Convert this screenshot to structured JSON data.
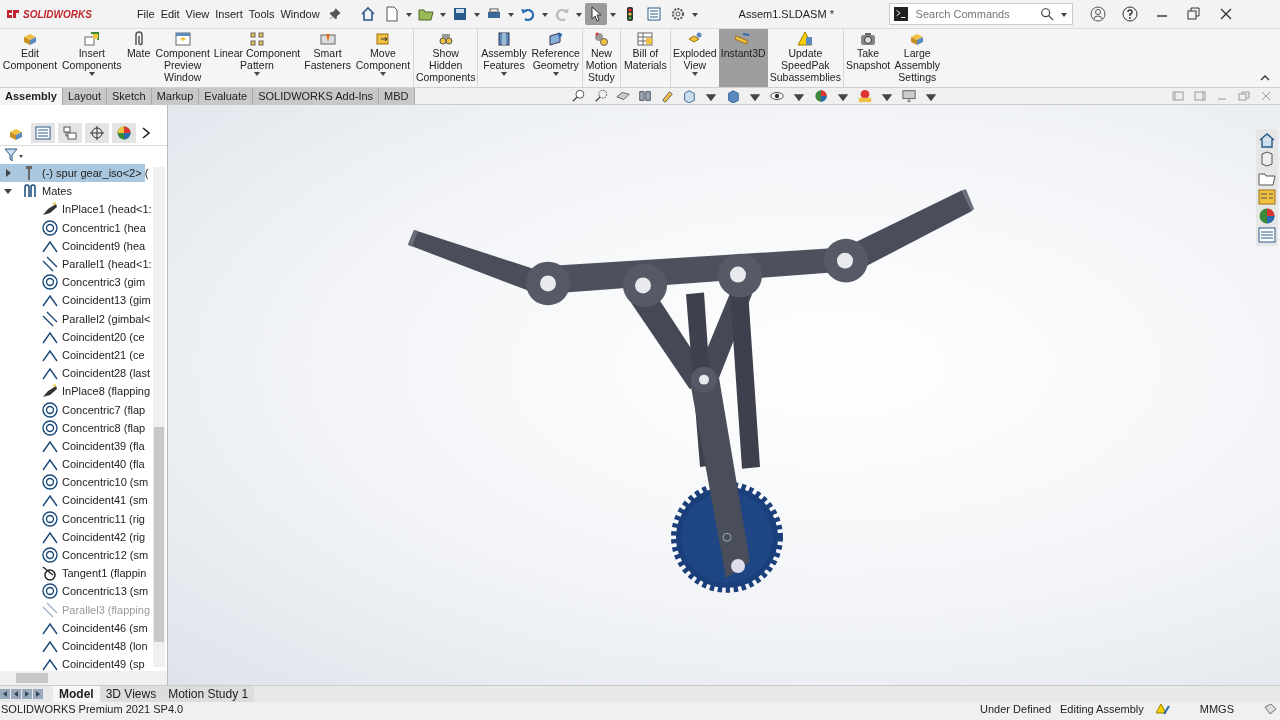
{
  "app": {
    "logo": "SOLIDWORKS",
    "menu": [
      "File",
      "Edit",
      "View",
      "Insert",
      "Tools",
      "Window"
    ],
    "document_title": "Assem1.SLDASM *",
    "search": {
      "placeholder": "Search Commands"
    }
  },
  "ribbon": {
    "items": [
      {
        "label": "Edit\nComponent",
        "dropdown": false,
        "active": false,
        "separator_before": false
      },
      {
        "label": "Insert\nComponents",
        "dropdown": true,
        "active": false,
        "separator_before": false
      },
      {
        "label": "Mate",
        "dropdown": false,
        "active": false,
        "separator_before": false
      },
      {
        "label": "Component\nPreview\nWindow",
        "dropdown": false,
        "active": false,
        "separator_before": false
      },
      {
        "label": "Linear Component\nPattern",
        "dropdown": true,
        "active": false,
        "separator_before": false
      },
      {
        "label": "Smart\nFasteners",
        "dropdown": false,
        "active": false,
        "separator_before": false
      },
      {
        "label": "Move\nComponent",
        "dropdown": true,
        "active": false,
        "separator_before": false
      },
      {
        "label": "Show\nHidden\nComponents",
        "dropdown": false,
        "active": false,
        "separator_before": true
      },
      {
        "label": "Assembly\nFeatures",
        "dropdown": true,
        "active": false,
        "separator_before": true
      },
      {
        "label": "Reference\nGeometry",
        "dropdown": true,
        "active": false,
        "separator_before": false
      },
      {
        "label": "New\nMotion\nStudy",
        "dropdown": false,
        "active": false,
        "separator_before": true
      },
      {
        "label": "Bill of\nMaterials",
        "dropdown": false,
        "active": false,
        "separator_before": true
      },
      {
        "label": "Exploded\nView",
        "dropdown": true,
        "active": false,
        "separator_before": true
      },
      {
        "label": "Instant3D",
        "dropdown": false,
        "active": true,
        "separator_before": false
      },
      {
        "label": "Update\nSpeedPak\nSubassemblies",
        "dropdown": false,
        "active": false,
        "separator_before": false
      },
      {
        "label": "Take\nSnapshot",
        "dropdown": false,
        "active": false,
        "separator_before": true
      },
      {
        "label": "Large\nAssembly\nSettings",
        "dropdown": false,
        "active": false,
        "separator_before": false
      }
    ]
  },
  "command_tabs": [
    {
      "label": "Assembly",
      "selected": true
    },
    {
      "label": "Layout",
      "selected": false
    },
    {
      "label": "Sketch",
      "selected": false
    },
    {
      "label": "Markup",
      "selected": false
    },
    {
      "label": "Evaluate",
      "selected": false
    },
    {
      "label": "SOLIDWORKS Add-Ins",
      "selected": false
    },
    {
      "label": "MBD",
      "selected": false
    }
  ],
  "feature_tree": {
    "items": [
      {
        "label": "(-) spur gear_iso<2> (",
        "kind": "part",
        "selected": true,
        "expanded": false
      },
      {
        "label": "Mates",
        "kind": "folder",
        "selected": false,
        "expanded": true,
        "children": [
          {
            "label": "InPlace1 (head<1:",
            "kind": "inplace",
            "suppressed": false
          },
          {
            "label": "Concentric1 (hea",
            "kind": "concentric",
            "suppressed": false
          },
          {
            "label": "Coincident9 (hea",
            "kind": "coincident",
            "suppressed": false
          },
          {
            "label": "Parallel1 (head<1:",
            "kind": "parallel",
            "suppressed": false
          },
          {
            "label": "Concentric3 (gim",
            "kind": "concentric",
            "suppressed": false
          },
          {
            "label": "Coincident13 (gim",
            "kind": "coincident",
            "suppressed": false
          },
          {
            "label": "Parallel2 (gimbal<",
            "kind": "parallel",
            "suppressed": false
          },
          {
            "label": "Coincident20 (ce",
            "kind": "coincident",
            "suppressed": false
          },
          {
            "label": "Coincident21 (ce",
            "kind": "coincident",
            "suppressed": false
          },
          {
            "label": "Coincident28 (last",
            "kind": "coincident",
            "suppressed": false
          },
          {
            "label": "InPlace8 (flapping",
            "kind": "inplace",
            "suppressed": false
          },
          {
            "label": "Concentric7 (flap",
            "kind": "concentric",
            "suppressed": false
          },
          {
            "label": "Concentric8 (flap",
            "kind": "concentric",
            "suppressed": false
          },
          {
            "label": "Coincident39 (fla",
            "kind": "coincident",
            "suppressed": false
          },
          {
            "label": "Coincident40 (fla",
            "kind": "coincident",
            "suppressed": false
          },
          {
            "label": "Concentric10 (sm",
            "kind": "concentric",
            "suppressed": false
          },
          {
            "label": "Coincident41 (sm",
            "kind": "coincident",
            "suppressed": false
          },
          {
            "label": "Concentric11 (rig",
            "kind": "concentric",
            "suppressed": false
          },
          {
            "label": "Coincident42 (rig",
            "kind": "coincident",
            "suppressed": false
          },
          {
            "label": "Concentric12 (sm",
            "kind": "concentric",
            "suppressed": false
          },
          {
            "label": "Tangent1 (flappin",
            "kind": "tangent",
            "suppressed": false
          },
          {
            "label": "Concentric13 (sm",
            "kind": "concentric",
            "suppressed": false
          },
          {
            "label": "Parallel3 (flapping",
            "kind": "parallel",
            "suppressed": true
          },
          {
            "label": "Coincident46 (sm",
            "kind": "coincident",
            "suppressed": false
          },
          {
            "label": "Coincident48 (lon",
            "kind": "coincident",
            "suppressed": false
          },
          {
            "label": "Coincident49 (sp",
            "kind": "coincident",
            "suppressed": false
          }
        ]
      }
    ]
  },
  "bottom_tabs": [
    {
      "label": "Model",
      "selected": true
    },
    {
      "label": "3D Views",
      "selected": false
    },
    {
      "label": "Motion Study 1",
      "selected": false
    }
  ],
  "status_bar": {
    "product": "SOLIDWORKS Premium 2021 SP4.0",
    "items": [
      "Under Defined",
      "Editing Assembly"
    ],
    "units": "MMGS"
  }
}
